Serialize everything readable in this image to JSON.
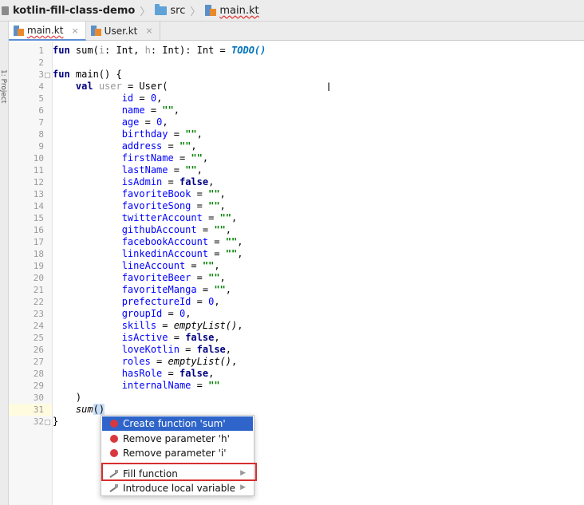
{
  "navbar": {
    "project": "kotlin-fill-class-demo",
    "folder": "src",
    "file": "main.kt"
  },
  "toolstrip": {
    "label": "1: Project"
  },
  "tabs": [
    {
      "label": "main.kt",
      "close": "×",
      "active": true
    },
    {
      "label": "User.kt",
      "close": "×",
      "active": false
    }
  ],
  "line_numbers": [
    "1",
    "2",
    "3",
    "4",
    "5",
    "6",
    "7",
    "8",
    "9",
    "10",
    "11",
    "12",
    "13",
    "14",
    "15",
    "16",
    "17",
    "18",
    "19",
    "20",
    "21",
    "22",
    "23",
    "24",
    "25",
    "26",
    "27",
    "28",
    "29",
    "30",
    "31",
    "32"
  ],
  "code": {
    "l1": {
      "kw": "fun",
      "pre": " sum(",
      "p1": "i",
      "mid1": ": Int, ",
      "p2": "h",
      "mid2": ": Int): Int = ",
      "todo": "TODO()"
    },
    "l3": {
      "kw": "fun",
      "rest": " main() {"
    },
    "l4": {
      "indent": "    ",
      "kw": "val",
      "var": " user",
      "rest": " = User("
    },
    "fields": [
      {
        "name": "id",
        "value": "0",
        "kind": "num"
      },
      {
        "name": "name",
        "value": "\"\"",
        "kind": "str"
      },
      {
        "name": "age",
        "value": "0",
        "kind": "num"
      },
      {
        "name": "birthday",
        "value": "\"\"",
        "kind": "str"
      },
      {
        "name": "address",
        "value": "\"\"",
        "kind": "str"
      },
      {
        "name": "firstName",
        "value": "\"\"",
        "kind": "str"
      },
      {
        "name": "lastName",
        "value": "\"\"",
        "kind": "str"
      },
      {
        "name": "isAdmin",
        "value": "false",
        "kind": "kw"
      },
      {
        "name": "favoriteBook",
        "value": "\"\"",
        "kind": "str"
      },
      {
        "name": "favoriteSong",
        "value": "\"\"",
        "kind": "str"
      },
      {
        "name": "twitterAccount",
        "value": "\"\"",
        "kind": "str"
      },
      {
        "name": "githubAccount",
        "value": "\"\"",
        "kind": "str"
      },
      {
        "name": "facebookAccount",
        "value": "\"\"",
        "kind": "str"
      },
      {
        "name": "linkedinAccount",
        "value": "\"\"",
        "kind": "str"
      },
      {
        "name": "lineAccount",
        "value": "\"\"",
        "kind": "str"
      },
      {
        "name": "favoriteBeer",
        "value": "\"\"",
        "kind": "str"
      },
      {
        "name": "favoriteManga",
        "value": "\"\"",
        "kind": "str"
      },
      {
        "name": "prefectureId",
        "value": "0",
        "kind": "num"
      },
      {
        "name": "groupId",
        "value": "0",
        "kind": "num"
      },
      {
        "name": "skills",
        "value": "emptyList()",
        "kind": "call"
      },
      {
        "name": "isActive",
        "value": "false",
        "kind": "kw"
      },
      {
        "name": "loveKotlin",
        "value": "false",
        "kind": "kw"
      },
      {
        "name": "roles",
        "value": "emptyList()",
        "kind": "call"
      },
      {
        "name": "hasRole",
        "value": "false",
        "kind": "kw"
      },
      {
        "name": "internalName",
        "value": "\"\"",
        "kind": "str"
      }
    ],
    "l30": "    )",
    "l31": {
      "indent": "    ",
      "call": "sum",
      "parens": "()"
    },
    "l32": "}"
  },
  "popup": {
    "items": [
      {
        "label": "Create function 'sum'",
        "icon": "error-bulb-icon",
        "selected": true
      },
      {
        "label": "Remove parameter 'h'",
        "icon": "error-bulb-icon",
        "selected": false
      },
      {
        "label": "Remove parameter 'i'",
        "icon": "error-bulb-icon",
        "selected": false
      },
      {
        "label": "Fill function",
        "icon": "intention-wand-icon",
        "submenu": true,
        "highlighted": true
      },
      {
        "label": "Introduce local variable",
        "icon": "intention-wand-icon",
        "submenu": true
      }
    ]
  },
  "colors": {
    "keyword": "#000080",
    "number": "#0000ff",
    "string": "#008000",
    "todo": "#0073bf",
    "selection": "#2f65ca",
    "highlight_box": "#d62f2f",
    "current_line": "#fffbdf"
  }
}
